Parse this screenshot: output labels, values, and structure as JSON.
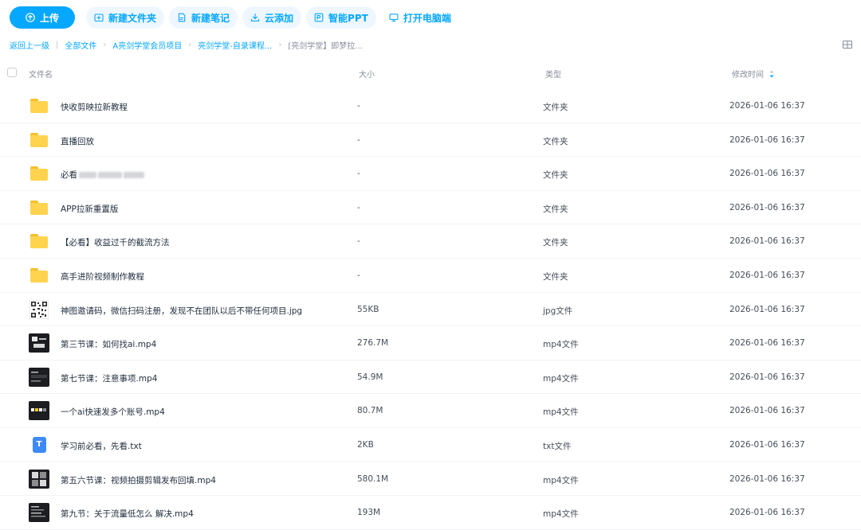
{
  "toolbar": {
    "upload_label": "上传",
    "buttons": [
      {
        "label": "新建文件夹",
        "icon": "new-folder-icon"
      },
      {
        "label": "新建笔记",
        "icon": "new-note-icon"
      },
      {
        "label": "云添加",
        "icon": "cloud-add-icon"
      },
      {
        "label": "智能PPT",
        "icon": "ppt-icon"
      },
      {
        "label": "打开电脑端",
        "icon": "desktop-icon"
      }
    ]
  },
  "breadcrumb": {
    "back": "返回上一级",
    "items": [
      "全部文件",
      "A亮剑学堂会员项目",
      "亮剑学堂-自录课程...",
      "[亮剑学堂】即梦拉..."
    ]
  },
  "header": {
    "name": "文件名",
    "size": "大小",
    "type": "类型",
    "time": "修改时间"
  },
  "files": [
    {
      "name": "快收剪映拉新教程",
      "size": "-",
      "type": "文件夹",
      "time": "2026-01-06 16:37",
      "icon": "folder-icon"
    },
    {
      "name": "直播回放",
      "size": "-",
      "type": "文件夹",
      "time": "2026-01-06 16:37",
      "icon": "folder-icon"
    },
    {
      "name": "必看",
      "size": "-",
      "type": "文件夹",
      "time": "2026-01-06 16:37",
      "icon": "folder-icon",
      "redacted": true
    },
    {
      "name": "APP拉新重置版",
      "size": "-",
      "type": "文件夹",
      "time": "2026-01-06 16:37",
      "icon": "folder-icon"
    },
    {
      "name": "【必看】收益过千的截流方法",
      "size": "-",
      "type": "文件夹",
      "time": "2026-01-06 16:37",
      "icon": "folder-icon"
    },
    {
      "name": "高手进阶视频制作教程",
      "size": "-",
      "type": "文件夹",
      "time": "2026-01-06 16:37",
      "icon": "folder-icon"
    },
    {
      "name": "神图邀请码，微信扫码注册，发现不在团队以后不带任何项目.jpg",
      "size": "55KB",
      "type": "jpg文件",
      "time": "2026-01-06 16:37",
      "icon": "qr-thumbnail-icon"
    },
    {
      "name": "第三节课：如何找ai.mp4",
      "size": "276.7M",
      "type": "mp4文件",
      "time": "2026-01-06 16:37",
      "icon": "video-thumbnail-icon"
    },
    {
      "name": "第七节课：注意事项.mp4",
      "size": "54.9M",
      "type": "mp4文件",
      "time": "2026-01-06 16:37",
      "icon": "video-thumbnail-icon"
    },
    {
      "name": "一个ai快速发多个账号.mp4",
      "size": "80.7M",
      "type": "mp4文件",
      "time": "2026-01-06 16:37",
      "icon": "video-thumbnail-icon"
    },
    {
      "name": "学习前必看，先看.txt",
      "size": "2KB",
      "type": "txt文件",
      "time": "2026-01-06 16:37",
      "icon": "txt-file-icon"
    },
    {
      "name": "第五六节课：视频拍摄剪辑发布回填.mp4",
      "size": "580.1M",
      "type": "mp4文件",
      "time": "2026-01-06 16:37",
      "icon": "video-thumbnail-icon"
    },
    {
      "name": "第九节：关于流量低怎么 解决.mp4",
      "size": "193M",
      "type": "mp4文件",
      "time": "2026-01-06 16:37",
      "icon": "video-thumbnail-icon"
    }
  ],
  "colors": {
    "accent": "#06a7ff",
    "folder": "#ffd34e"
  }
}
